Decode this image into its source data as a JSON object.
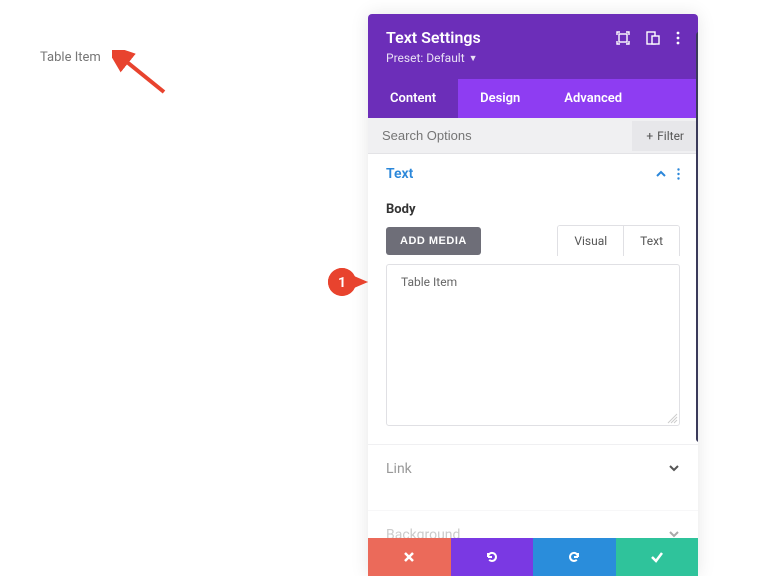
{
  "canvas": {
    "text": "Table Item"
  },
  "callout": {
    "number": "1"
  },
  "header": {
    "title": "Text Settings",
    "preset_label": "Preset: Default",
    "icons": {
      "expand": "expand-icon",
      "responsive": "responsive-icon",
      "more": "more-icon"
    }
  },
  "tabs": {
    "content": "Content",
    "design": "Design",
    "advanced": "Advanced"
  },
  "search": {
    "placeholder": "Search Options",
    "filter_label": "Filter"
  },
  "section_text": {
    "title": "Text",
    "body_label": "Body",
    "add_media": "ADD MEDIA",
    "editor_tabs": {
      "visual": "Visual",
      "text": "Text"
    },
    "editor_value": "Table Item"
  },
  "sections": {
    "link": "Link",
    "background": "Background"
  },
  "footer_icons": {
    "close": "close-icon",
    "undo": "undo-icon",
    "redo": "redo-icon",
    "confirm": "check-icon"
  },
  "colors": {
    "purple_dark": "#6c2eb9",
    "purple_light": "#8e3df2",
    "blue_text": "#2b87da",
    "red": "#eb6a5a",
    "undo": "#7a39e3",
    "redo": "#2a8ddb",
    "green": "#2fc39b"
  }
}
